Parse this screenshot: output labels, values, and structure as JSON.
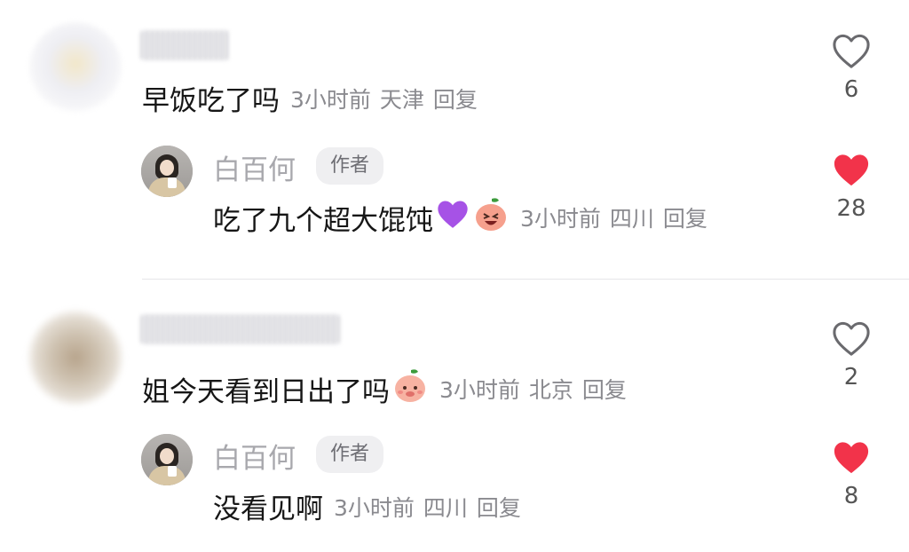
{
  "comments": [
    {
      "text": "早饭吃了吗",
      "time": "3小时前",
      "location": "天津",
      "reply_label": "回复",
      "likes": "6",
      "liked": false,
      "reply": {
        "author": "白百何",
        "badge": "作者",
        "text": "吃了九个超大馄饨",
        "time": "3小时前",
        "location": "四川",
        "reply_label": "回复",
        "likes": "28",
        "liked": true
      }
    },
    {
      "text": "姐今天看到日出了吗",
      "time": "3小时前",
      "location": "北京",
      "reply_label": "回复",
      "likes": "2",
      "liked": false,
      "reply": {
        "author": "白百何",
        "badge": "作者",
        "text": "没看见啊",
        "time": "3小时前",
        "location": "四川",
        "reply_label": "回复",
        "likes": "8",
        "liked": true
      }
    }
  ],
  "colors": {
    "liked_heart": "#f2334a",
    "outline_heart": "#6a6a6e",
    "meta_text": "#8a8a8f"
  },
  "icons": [
    "heart-outline-icon",
    "heart-filled-icon",
    "purple-heart-emoji",
    "peach-laughing-emoji",
    "peach-shy-emoji"
  ]
}
